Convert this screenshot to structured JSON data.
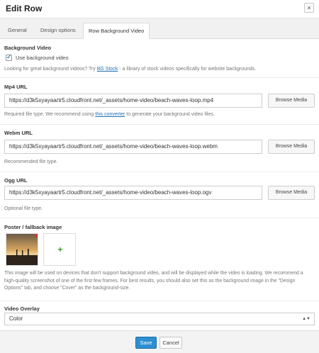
{
  "dialog": {
    "title": "Edit Row",
    "close_label": "×"
  },
  "tabs": [
    {
      "label": "General"
    },
    {
      "label": "Design options"
    },
    {
      "label": "Row Background Video"
    }
  ],
  "background_video": {
    "section_label": "Background Video",
    "checkbox_label": "Use background video",
    "checked": true,
    "help_prefix": "Looking for great background videos? Try ",
    "help_link": "BG Stock",
    "help_suffix": " - a library of stock videos specifically for website backgrounds."
  },
  "mp4": {
    "label": "Mp4 URL",
    "value": "https://d3k5xyayaartr5.cloudfront.net/_assets/home-video/beach-waves-loop.mp4",
    "browse_label": "Browse Media",
    "help_prefix": "Required file type. We recommend using ",
    "help_link": "this converter",
    "help_suffix": " to generate your background video files."
  },
  "webm": {
    "label": "Webm URL",
    "value": "https://d3k5xyayaartr5.cloudfront.net/_assets/home-video/beach-waves-loop.webm",
    "browse_label": "Browse Media",
    "help": "Recommended file type."
  },
  "ogg": {
    "label": "Ogg URL",
    "value": "https://d3k5xyayaartr5.cloudfront.net/_assets/home-video/beach-waves-loop.ogv",
    "browse_label": "Browse Media",
    "help": "Optional file type."
  },
  "poster": {
    "label": "Poster / fallback image",
    "remove_label": "✖",
    "add_label": "+",
    "help": "This image will be used on devices that don't support background video, and will be displayed while the video is loading. We recommend a high-quality screenshot of one of the first few frames. For best results, you should also set this as the background image in the \"Design Options\" tab, and choose \"Cover\" as the background-size."
  },
  "overlay": {
    "label": "Video Overlay",
    "selected": "Color",
    "arrow": "▲▼"
  },
  "footer": {
    "save_label": "Save",
    "cancel_label": "Cancel"
  },
  "colors": {
    "accent": "#2d8fd2",
    "link": "#2271b1",
    "remove": "#dd3333",
    "add": "#3a9d23"
  },
  "icons": {
    "close": "close-icon",
    "check": "checkmark-icon",
    "remove": "remove-x-icon",
    "add": "plus-icon",
    "select_arrow": "chevron-up-down-icon"
  }
}
